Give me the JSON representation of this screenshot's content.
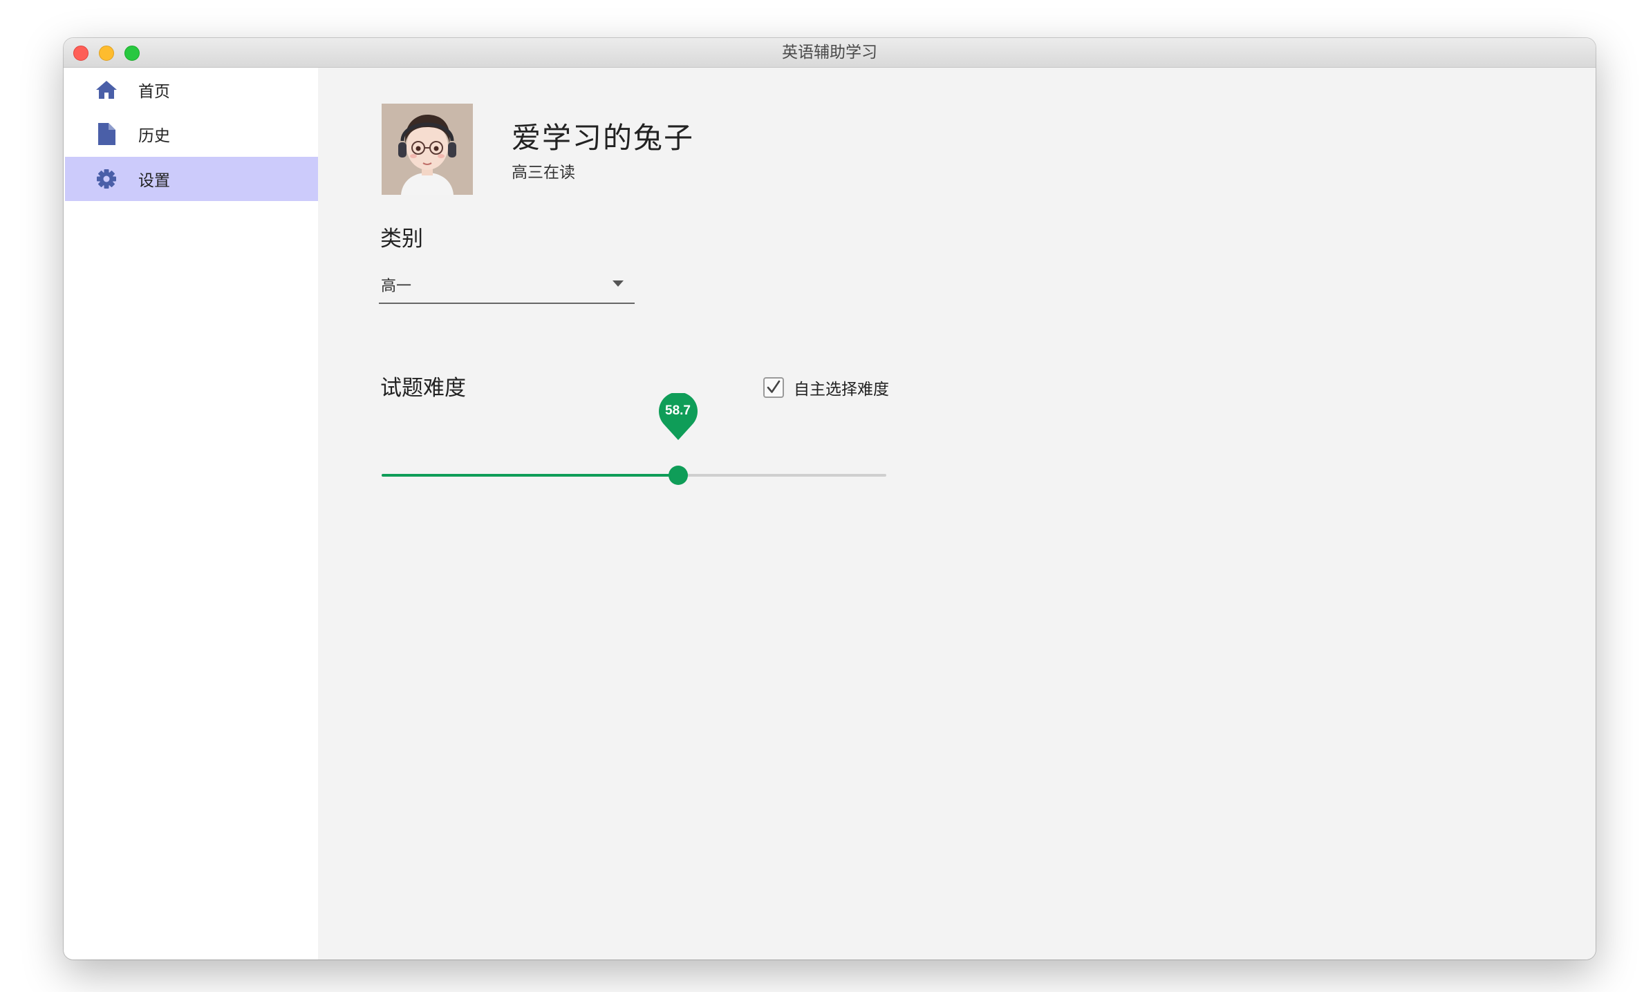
{
  "window": {
    "title": "英语辅助学习"
  },
  "sidebar": {
    "items": [
      {
        "label": "首页",
        "icon": "home-icon",
        "active": false
      },
      {
        "label": "历史",
        "icon": "document-icon",
        "active": false
      },
      {
        "label": "设置",
        "icon": "gear-icon",
        "active": true
      }
    ]
  },
  "profile": {
    "name": "爱学习的兔子",
    "grade": "高三在读"
  },
  "category": {
    "title": "类别",
    "selected": "高一"
  },
  "difficulty": {
    "title": "试题难度",
    "checkbox_label": "自主选择难度",
    "checkbox_checked": true,
    "value_label": "58.7",
    "value": 58.7,
    "min": 0,
    "max": 100
  },
  "colors": {
    "accent": "#0f9d58",
    "sidebar_active": "#cccbfb",
    "nav_icon": "#4a5fa8"
  }
}
